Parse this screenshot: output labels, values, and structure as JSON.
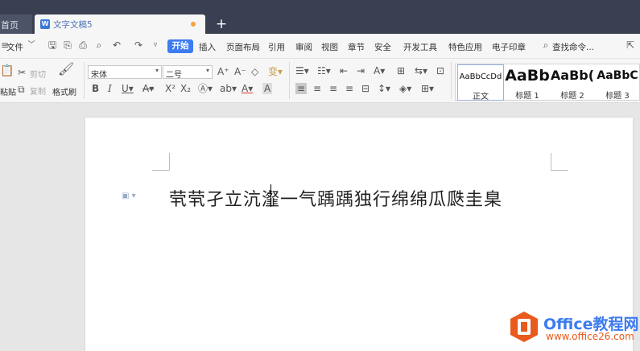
{
  "tabs": {
    "home": "首页",
    "doc_title": "文字文稿5",
    "new_tab": "+"
  },
  "menu": {
    "file": "文件",
    "items": [
      "开始",
      "插入",
      "页面布局",
      "引用",
      "审阅",
      "视图",
      "章节",
      "安全",
      "开发工具",
      "特色应用",
      "电子印章"
    ],
    "search": "查找命令..."
  },
  "ribbon": {
    "paste": "粘贴",
    "cut": "剪切",
    "copy": "复制",
    "format_painter": "格式刷",
    "font_name": "宋体",
    "font_size": "二号",
    "styles": [
      {
        "preview": "AaBbCcDd",
        "name": "正文"
      },
      {
        "preview": "AaBb",
        "name": "标题 1"
      },
      {
        "preview": "AaBb(",
        "name": "标题 2"
      },
      {
        "preview": "AaBbC",
        "name": "标题 3"
      }
    ]
  },
  "document": {
    "text": "茕茕孑立沆瀣一气踽踽独行绵绵瓜瓞圭臬"
  },
  "logo": {
    "title": "Office教程网",
    "url": "www.office26.com"
  },
  "colors": {
    "accent": "#3d7cf0",
    "tabbar": "#3a3f51",
    "logo_orange": "#e95a1d"
  }
}
